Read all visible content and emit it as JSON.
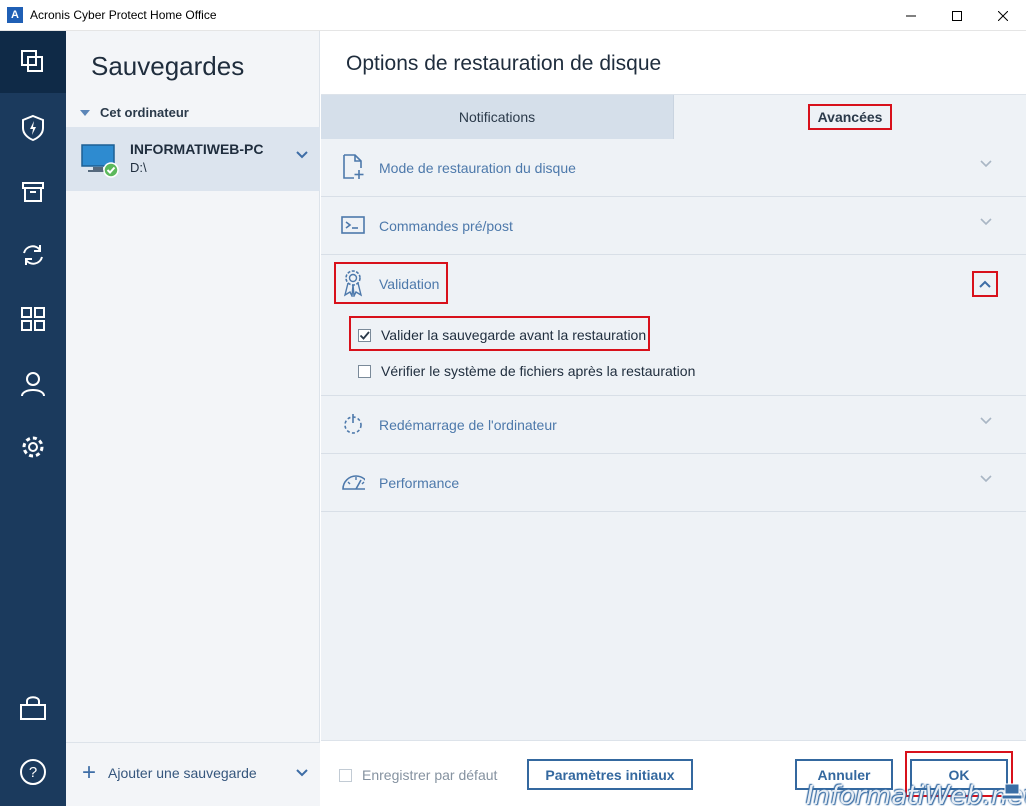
{
  "window": {
    "title": "Acronis Cyber Protect Home Office",
    "logo_letter": "A"
  },
  "rail": {
    "items": [
      "backups-icon",
      "protection-icon",
      "archive-icon",
      "sync-icon",
      "dashboard-icon",
      "account-icon",
      "settings-icon",
      "store-icon",
      "help-icon"
    ],
    "active": "backups-icon"
  },
  "sidebar": {
    "title": "Sauvegardes",
    "group_label": "Cet ordinateur",
    "backup": {
      "name": "INFORMATIWEB-PC",
      "path": "D:\\"
    },
    "add_label": "Ajouter une sauvegarde"
  },
  "main": {
    "title": "Options de restauration de disque",
    "tabs": [
      {
        "label": "Notifications",
        "active": false
      },
      {
        "label": "Avancées",
        "active": true
      }
    ],
    "sections": {
      "mode": "Mode de restauration du disque",
      "commands": "Commandes pré/post",
      "validation": "Validation",
      "reboot": "Redémarrage de l'ordinateur",
      "performance": "Performance"
    },
    "validation_options": [
      {
        "label": "Valider la sauvegarde avant la restauration",
        "checked": true
      },
      {
        "label": "Vérifier le système de fichiers après la restauration",
        "checked": false
      }
    ]
  },
  "footer": {
    "save_default": "Enregistrer par défaut",
    "reset": "Paramètres initiaux",
    "cancel": "Annuler",
    "ok": "OK"
  },
  "watermark": "InformatiWeb.net",
  "colors": {
    "rail_bg": "#1b3a5d",
    "accent": "#4d79ab",
    "highlight": "#d8111b"
  }
}
